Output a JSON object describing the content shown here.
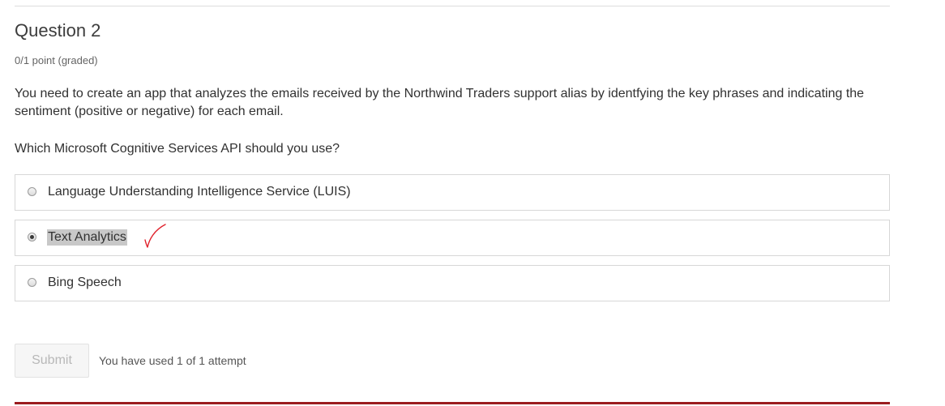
{
  "problem": {
    "title": "Question 2",
    "grade": "0/1 point (graded)",
    "prompt": "You need to create an app that analyzes the emails received by the Northwind Traders support alias by identfying the key phrases and indicating the sentiment (positive or negative) for each email.",
    "question": "Which Microsoft Cognitive Services API should you use?"
  },
  "options": [
    {
      "label": "Language Understanding Intelligence Service (LUIS)",
      "selected": false
    },
    {
      "label": "Text Analytics",
      "selected": true,
      "highlighted": true,
      "annotation": "red-checkmark"
    },
    {
      "label": "Bing Speech",
      "selected": false
    }
  ],
  "actions": {
    "submit_label": "Submit",
    "submit_enabled": false,
    "attempts_text": "You have used 1 of 1 attempt"
  },
  "colors": {
    "bottom_rule": "#9b1c1f",
    "annotation": "#e0202a",
    "highlight": "#c8c8c8"
  }
}
